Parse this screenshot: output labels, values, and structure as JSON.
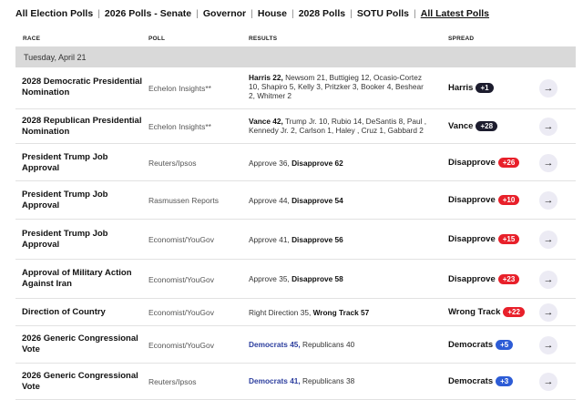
{
  "nav": {
    "items": [
      {
        "label": "All Election Polls",
        "sep": "|"
      },
      {
        "label": "2026 Polls -",
        "sep": ""
      },
      {
        "label": "Senate",
        "sep": "|"
      },
      {
        "label": "Governor",
        "sep": "|"
      },
      {
        "label": "House",
        "sep": "|"
      },
      {
        "label": "2028 Polls",
        "sep": "|"
      },
      {
        "label": "SOTU Polls",
        "sep": "|"
      },
      {
        "label": "All Latest Polls",
        "sep": ""
      }
    ]
  },
  "table": {
    "headers": {
      "race": "RACE",
      "poll": "POLL",
      "results": "RESULTS",
      "spread": "SPREAD"
    },
    "date": "Tuesday, April 21",
    "colors": {
      "rep": "#e8202a",
      "dem": "#2d5cd6",
      "dark": "#1c1c2e"
    },
    "rows": [
      {
        "race": "2028 Democratic Presidential Nomination",
        "poll": "Echelon Insights**",
        "results_bold": "Harris 22,",
        "results_rest": " Newsom 21, Buttigieg 12, Ocasio-Cortez 10, Shapiro 5, Kelly 3, Pritzker 3, Booker 4, Beshear 2, Whitmer 2",
        "spread_label": "Harris",
        "spread_value": "+1",
        "spread_color": "dark"
      },
      {
        "race": "2028 Republican Presidential Nomination",
        "poll": "Echelon Insights**",
        "results_bold": "Vance 42,",
        "results_rest": " Trump Jr. 10, Rubio 14, DeSantis 8, Paul , Kennedy Jr. 2, Carlson 1, Haley , Cruz 1, Gabbard 2",
        "spread_label": "Vance",
        "spread_value": "+28",
        "spread_color": "dark"
      },
      {
        "race": "President Trump Job Approval",
        "poll": "Reuters/Ipsos",
        "results_plain": "Approve 36,",
        "results_bold2": "Disapprove 62",
        "spread_label": "Disapprove",
        "spread_value": "+26",
        "spread_color": "rep"
      },
      {
        "race": "President Trump Job Approval",
        "poll": "Rasmussen Reports",
        "results_plain": "Approve 44,",
        "results_bold2": "Disapprove 54",
        "spread_label": "Disapprove",
        "spread_value": "+10",
        "spread_color": "rep"
      },
      {
        "race": "President Trump Job Approval",
        "poll": "Economist/YouGov",
        "results_plain": "Approve 41,",
        "results_bold2": "Disapprove 56",
        "spread_label": "Disapprove",
        "spread_value": "+15",
        "spread_color": "rep"
      },
      {
        "race": "Approval of Military Action Against Iran",
        "poll": "Economist/YouGov",
        "results_plain": "Approve 35,",
        "results_bold2": "Disapprove 58",
        "spread_label": "Disapprove",
        "spread_value": "+23",
        "spread_color": "rep"
      },
      {
        "race": "Direction of Country",
        "poll": "Economist/YouGov",
        "results_plain": "Right Direction 35,",
        "results_bold2": "Wrong Track 57",
        "spread_label": "Wrong Track",
        "spread_value": "+22",
        "spread_color": "rep"
      },
      {
        "race": "2026 Generic Congressional Vote",
        "poll": "Economist/YouGov",
        "results_blue": "Democrats 45,",
        "results_rest": " Republicans 40",
        "spread_label": "Democrats",
        "spread_value": "+5",
        "spread_color": "dem"
      },
      {
        "race": "2026 Generic Congressional Vote",
        "poll": "Reuters/Ipsos",
        "results_blue": "Democrats 41,",
        "results_rest": " Republicans 38",
        "spread_label": "Democrats",
        "spread_value": "+3",
        "spread_color": "dem"
      }
    ]
  }
}
